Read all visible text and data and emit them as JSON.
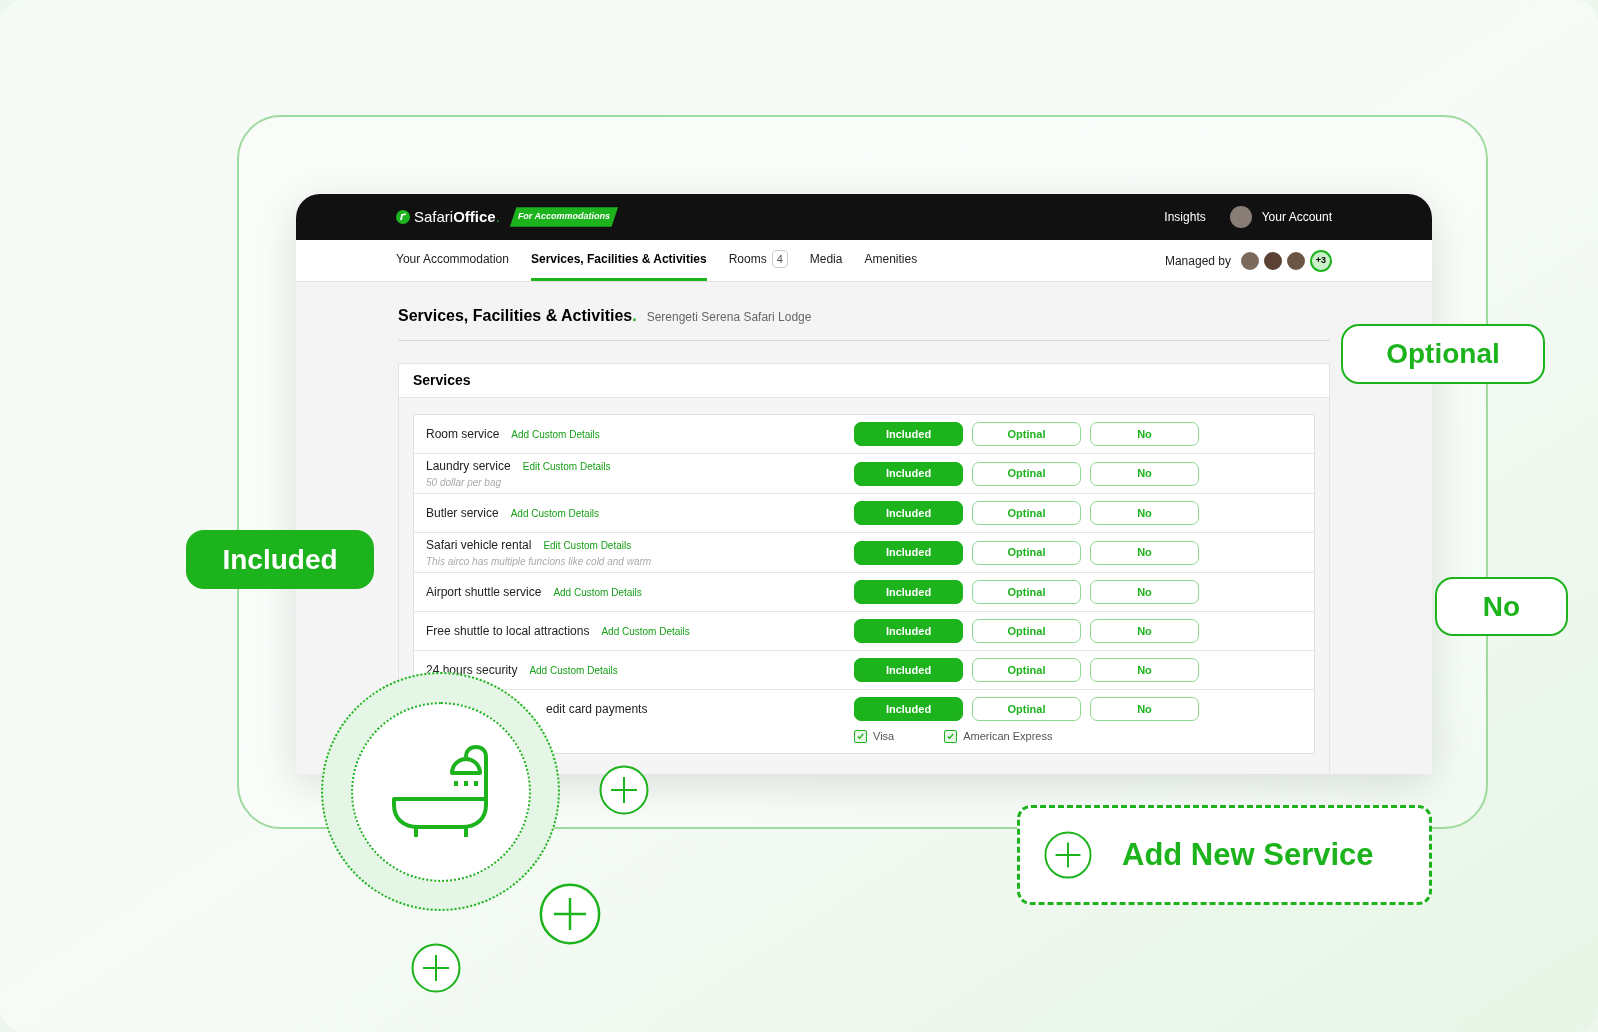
{
  "header": {
    "brand_light": "Safari",
    "brand_bold": "Office",
    "brand_dot": ".",
    "badge": "For Accommodations",
    "insights": "Insights",
    "account": "Your Account"
  },
  "tabs": [
    {
      "label": "Your Accommodation",
      "selected": false
    },
    {
      "label": "Services, Facilities & Activities",
      "selected": true
    },
    {
      "label": "Rooms",
      "count": "4",
      "selected": false
    },
    {
      "label": "Media",
      "selected": false
    },
    {
      "label": "Amenities",
      "selected": false
    }
  ],
  "managed_by": {
    "label": "Managed by",
    "extra": "+3"
  },
  "page": {
    "title": "Services, Facilities & Activities",
    "dot": ".",
    "subtitle": "Serengeti Serena Safari Lodge"
  },
  "section": {
    "title": "Services",
    "rows": [
      {
        "name": "Room service",
        "link": "Add Custom Details",
        "options": [
          {
            "label": "Included",
            "selected": true
          },
          {
            "label": "Optinal",
            "selected": false
          },
          {
            "label": "No",
            "selected": false
          }
        ]
      },
      {
        "name": "Laundry service",
        "link": "Edit Custom Details",
        "note": "50 dollar per bag",
        "options": [
          {
            "label": "Included",
            "selected": true
          },
          {
            "label": "Optinal",
            "selected": false
          },
          {
            "label": "No",
            "selected": false
          }
        ]
      },
      {
        "name": "Butler service",
        "link": "Add Custom Details",
        "options": [
          {
            "label": "Included",
            "selected": true
          },
          {
            "label": "Optinal",
            "selected": false
          },
          {
            "label": "No",
            "selected": false
          }
        ]
      },
      {
        "name": "Safari vehicle rental",
        "link": "Edit Custom Details",
        "note": "This airco has multiple funcions like cold and warm",
        "options": [
          {
            "label": "Included",
            "selected": true
          },
          {
            "label": "Optinal",
            "selected": false
          },
          {
            "label": "No",
            "selected": false
          }
        ]
      },
      {
        "name": "Airport shuttle service",
        "link": "Add Custom Details",
        "options": [
          {
            "label": "Included",
            "selected": true
          },
          {
            "label": "Optinal",
            "selected": false
          },
          {
            "label": "No",
            "selected": false
          }
        ]
      },
      {
        "name": "Free shuttle to local attractions",
        "link": "Add Custom Details",
        "options": [
          {
            "label": "Included",
            "selected": true
          },
          {
            "label": "Optinal",
            "selected": false
          },
          {
            "label": "No",
            "selected": false
          }
        ]
      },
      {
        "name": "24 hours security",
        "link": "Add Custom Details",
        "options": [
          {
            "label": "Included",
            "selected": true
          },
          {
            "label": "Optinal",
            "selected": false
          },
          {
            "label": "No",
            "selected": false
          }
        ]
      },
      {
        "name": "edit card payments",
        "covered": true,
        "options": [
          {
            "label": "Included",
            "selected": true
          },
          {
            "label": "Optinal",
            "selected": false
          },
          {
            "label": "No",
            "selected": false
          }
        ],
        "payment_options": [
          {
            "label": "Visa",
            "checked": true
          },
          {
            "label": "American Express",
            "checked": true
          }
        ]
      }
    ]
  },
  "callouts": [
    {
      "kind": "filled",
      "label": "Included"
    },
    {
      "kind": "outline",
      "label": "Optional"
    },
    {
      "kind": "outline",
      "label": "No"
    }
  ],
  "add_service": {
    "label": "Add New Service"
  }
}
